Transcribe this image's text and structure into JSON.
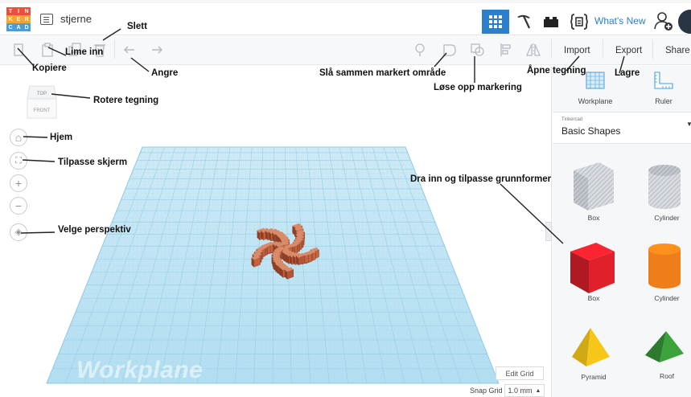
{
  "app": {
    "logo_letters": [
      "T",
      "I",
      "N",
      "K",
      "E",
      "R",
      "C",
      "A",
      "D"
    ],
    "logo_colors": [
      "#e8513d",
      "#e8513d",
      "#e8513d",
      "#f2a533",
      "#f2a533",
      "#f2a533",
      "#4a9ed8",
      "#4a9ed8",
      "#4a9ed8"
    ],
    "document_title": "stjerne",
    "whats_new": "What's New",
    "accent_color": "#2d7ecb"
  },
  "header": {
    "view_buttons": [
      {
        "name": "3d-design-view",
        "icon": "grid-icon",
        "active": true
      },
      {
        "name": "build-view",
        "icon": "pickaxe-icon",
        "active": false
      },
      {
        "name": "bricks-view",
        "icon": "brick-icon",
        "active": false
      },
      {
        "name": "codeblocks-view",
        "icon": "code-blocks-icon",
        "active": false
      }
    ]
  },
  "toolbar": {
    "left_icons": [
      "copy-icon",
      "paste-icon",
      "duplicate-icon",
      "delete-icon",
      "undo-icon",
      "redo-icon"
    ],
    "right_icons": [
      "light-icon",
      "group-icon",
      "ungroup-icon",
      "align-icon",
      "mirror-icon"
    ],
    "import_label": "Import",
    "export_label": "Export",
    "share_label": "Share"
  },
  "sidebar": {
    "workplane_label": "Workplane",
    "ruler_label": "Ruler",
    "category_label": "Tinkercad",
    "category_name": "Basic Shapes",
    "shapes": [
      {
        "label": "Box",
        "style": "hole"
      },
      {
        "label": "Cylinder",
        "style": "hole"
      },
      {
        "label": "Box",
        "style": "solid",
        "color": "#e0202b"
      },
      {
        "label": "Cylinder",
        "style": "solid",
        "color": "#ee7d1a"
      },
      {
        "label": "Pyramid",
        "style": "solid",
        "color": "#f6c719"
      },
      {
        "label": "Roof",
        "style": "solid",
        "color": "#3ca33c"
      }
    ]
  },
  "viewport": {
    "view_cube_top": "TOP",
    "view_cube_front": "FRONT",
    "nav_icons": [
      "home-icon",
      "fit-icon",
      "zoom-in-icon",
      "zoom-out-icon",
      "perspective-icon"
    ],
    "workplane_watermark": "Workplane",
    "edit_grid_label": "Edit Grid",
    "snap_grid_label": "Snap Grid",
    "snap_grid_value": "1.0 mm",
    "grid_color": "#b5dff0",
    "model_color": "#c4633e"
  },
  "annotations": [
    {
      "key": "slett",
      "text": "Slett"
    },
    {
      "key": "kopiere",
      "text": "Kopiere"
    },
    {
      "key": "lime_inn",
      "text": "Lime inn"
    },
    {
      "key": "angre",
      "text": "Angre"
    },
    {
      "key": "rotere",
      "text": "Rotere tegning"
    },
    {
      "key": "hjem",
      "text": "Hjem"
    },
    {
      "key": "tilpasse",
      "text": "Tilpasse skjerm"
    },
    {
      "key": "perspektiv",
      "text": "Velge perspektiv"
    },
    {
      "key": "sla_sammen",
      "text": "Slå sammen markert område"
    },
    {
      "key": "lose_opp",
      "text": "Løse opp markering"
    },
    {
      "key": "apne",
      "text": "Åpne tegning"
    },
    {
      "key": "lagre",
      "text": "Lagre"
    },
    {
      "key": "dra_inn",
      "text": "Dra inn og tilpasse grunnformer"
    }
  ]
}
